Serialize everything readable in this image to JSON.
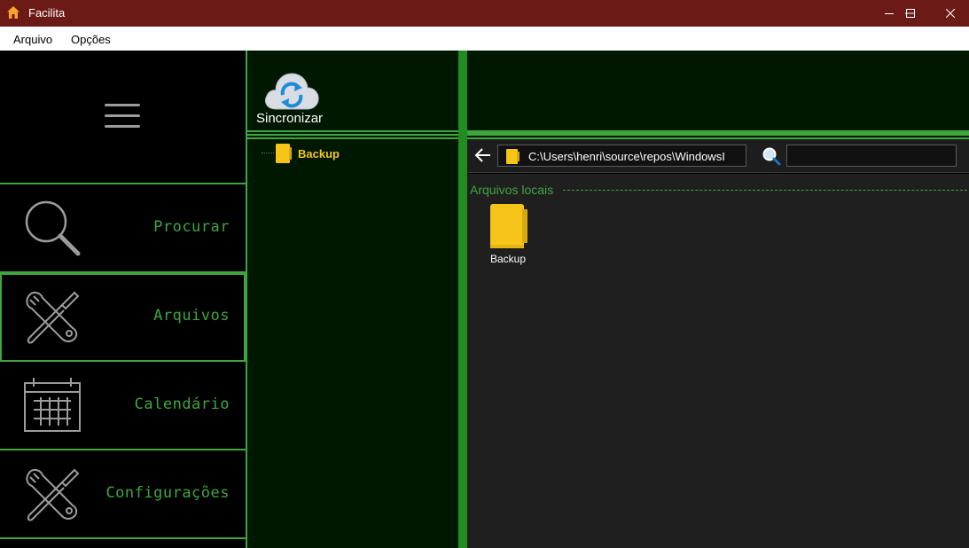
{
  "window": {
    "title": "Facilita",
    "app_icon": "home-icon",
    "controls": [
      "minimize-icon",
      "maximize-icon",
      "close-icon"
    ]
  },
  "menubar": {
    "items": [
      {
        "label": "Arquivo"
      },
      {
        "label": "Opções"
      }
    ]
  },
  "sidebar": {
    "toggle_icon": "hamburger-icon",
    "items": [
      {
        "label": "Procurar",
        "icon": "search-icon",
        "active": false
      },
      {
        "label": "Arquivos",
        "icon": "tools-icon",
        "active": true
      },
      {
        "label": "Calendário",
        "icon": "calendar-icon",
        "active": false
      },
      {
        "label": "Configurações",
        "icon": "tools-icon",
        "active": false
      }
    ]
  },
  "tree_panel": {
    "sync_button": {
      "label": "Sincronizar",
      "icon": "cloud-sync-icon"
    },
    "nodes": [
      {
        "label": "Backup",
        "icon": "folder-icon"
      }
    ]
  },
  "explorer": {
    "path": "C:\\Users\\henri\\source\\repos\\WindowsI",
    "search_value": "",
    "group_header": "Arquivos locais",
    "items": [
      {
        "label": "Backup",
        "icon": "folder-icon"
      }
    ]
  },
  "colors": {
    "title_bar": "#6b1a16",
    "accent_green": "#3fa63f",
    "splitter_green": "#228b22",
    "panel_dark_green": "#001800",
    "folder_yellow": "#f5c518",
    "content_bg": "#1f1f1f"
  }
}
